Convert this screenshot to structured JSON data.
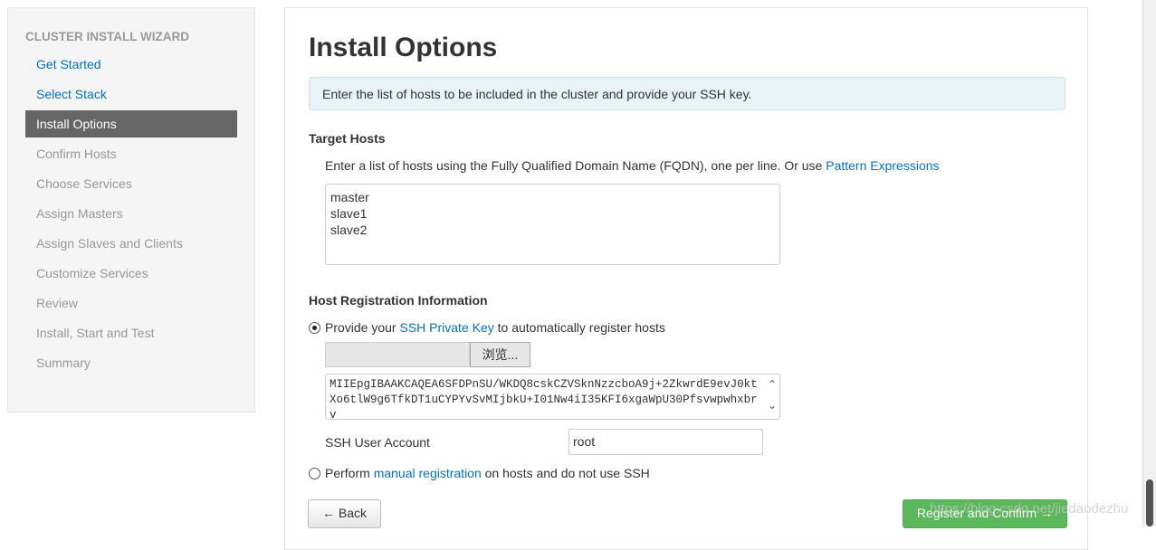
{
  "sidebar": {
    "title": "CLUSTER INSTALL WIZARD",
    "items": [
      {
        "label": "Get Started",
        "state": "done"
      },
      {
        "label": "Select Stack",
        "state": "done"
      },
      {
        "label": "Install Options",
        "state": "active"
      },
      {
        "label": "Confirm Hosts",
        "state": "pending"
      },
      {
        "label": "Choose Services",
        "state": "pending"
      },
      {
        "label": "Assign Masters",
        "state": "pending"
      },
      {
        "label": "Assign Slaves and Clients",
        "state": "pending"
      },
      {
        "label": "Customize Services",
        "state": "pending"
      },
      {
        "label": "Review",
        "state": "pending"
      },
      {
        "label": "Install, Start and Test",
        "state": "pending"
      },
      {
        "label": "Summary",
        "state": "pending"
      }
    ]
  },
  "main": {
    "title": "Install Options",
    "alert": "Enter the list of hosts to be included in the cluster and provide your SSH key.",
    "target_hosts": {
      "heading": "Target Hosts",
      "hint": "Enter a list of hosts using the Fully Qualified Domain Name (FQDN), one per line. Or use ",
      "hint_link": "Pattern Expressions",
      "value": "master\nslave1\nslave2"
    },
    "registration": {
      "heading": "Host Registration Information",
      "opt1_pre": "Provide your ",
      "opt1_link": "SSH Private Key",
      "opt1_post": " to automatically register hosts",
      "browse_label": "浏览...",
      "key_value": "MIIEpgIBAAKCAQEA6SFDPnSU/WKDQ8cskCZVSknNzzcboA9j+2ZkwrdE9evJ0ktXo6tlW9g6TfkDT1uCYPYvSvMIjbkU+I01Nw4iI35KFI6xgaWpU30Pfsvwpwhxbrv",
      "ssh_user_label": "SSH User Account",
      "ssh_user_value": "root",
      "opt2_pre": "Perform ",
      "opt2_link": "manual registration",
      "opt2_post": " on hosts and do not use SSH",
      "selected": "ssh"
    },
    "back_label": "← Back",
    "register_label": "Register and Confirm →"
  },
  "watermark": "https://blog.csdn.net/jiedaodezhu"
}
